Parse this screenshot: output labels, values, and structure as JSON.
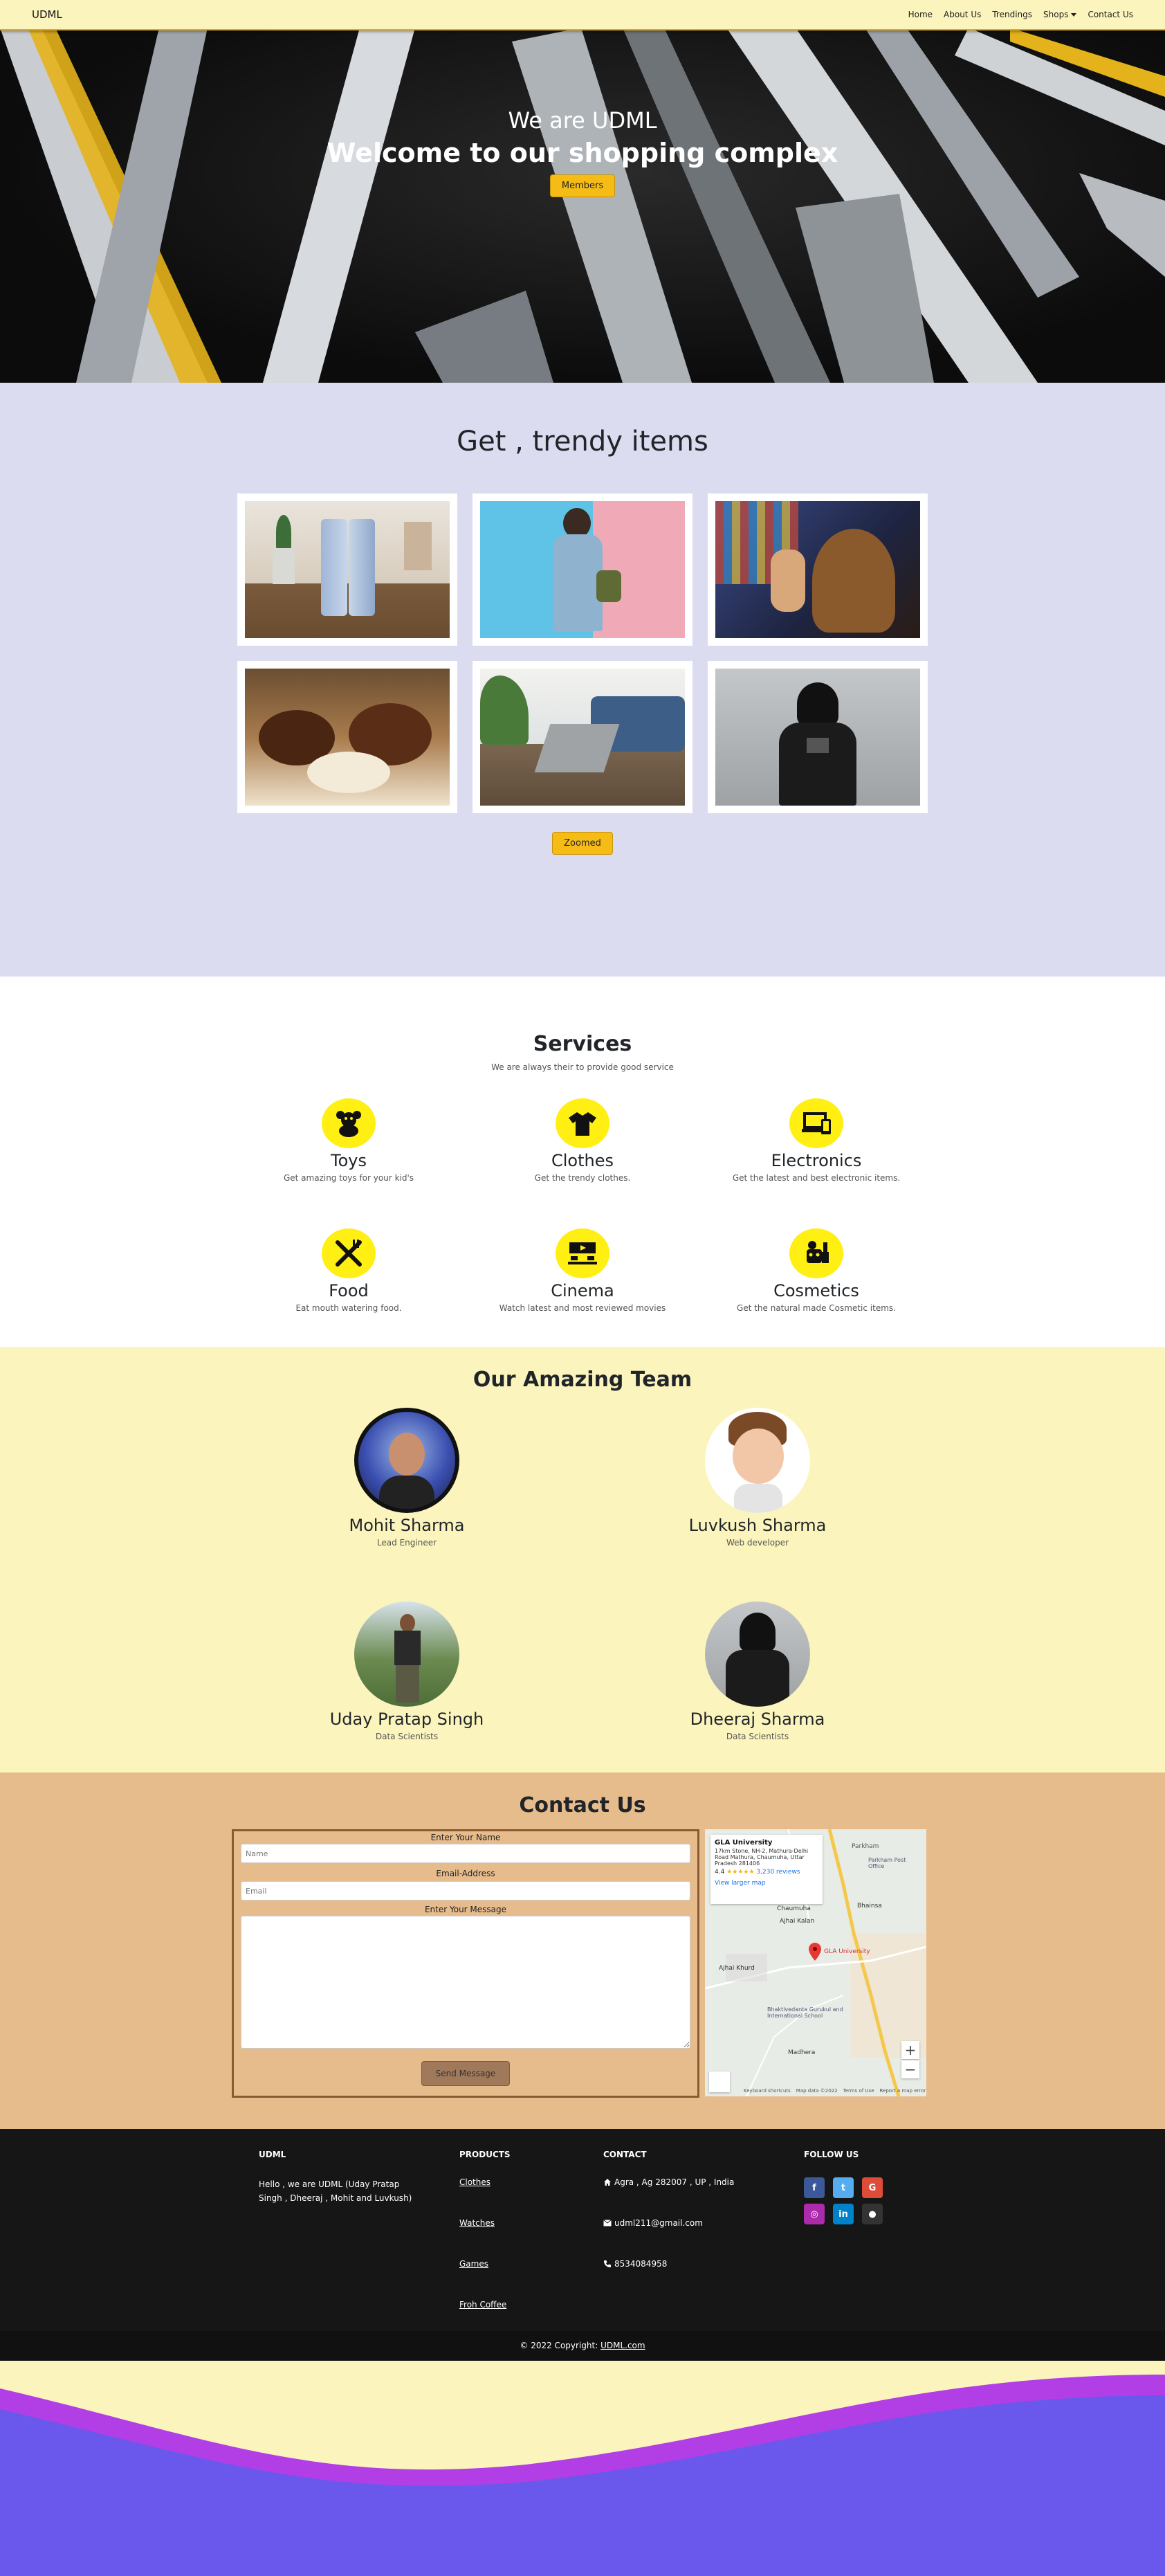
{
  "nav": {
    "brand": "UDML",
    "links": [
      "Home",
      "About Us",
      "Trendings",
      "Shops",
      "Contact Us"
    ]
  },
  "hero": {
    "subtitle": "We are UDML",
    "title": "Welcome to our shopping complex",
    "button": "Members"
  },
  "trendy": {
    "title": "Get , trendy items",
    "button": "Zoomed"
  },
  "services": {
    "title": "Services",
    "tagline": "We are always their to provide good service",
    "items": [
      {
        "name": "Toys",
        "desc": "Get amazing toys for your kid's",
        "icon": "teddy-bear-icon"
      },
      {
        "name": "Clothes",
        "desc": "Get the trendy clothes.",
        "icon": "shirt-icon"
      },
      {
        "name": "Electronics",
        "desc": "Get the latest and best electronic items.",
        "icon": "devices-icon"
      },
      {
        "name": "Food",
        "desc": "Eat mouth watering food.",
        "icon": "utensils-icon"
      },
      {
        "name": "Cinema",
        "desc": "Watch latest and most reviewed movies",
        "icon": "cinema-icon"
      },
      {
        "name": "Cosmetics",
        "desc": "Get the natural made Cosmetic items.",
        "icon": "cosmetics-icon"
      }
    ]
  },
  "team": {
    "title": "Our Amazing Team",
    "members": [
      {
        "name": "Mohit Sharma",
        "role": "Lead Engineer"
      },
      {
        "name": "Luvkush Sharma",
        "role": "Web developer"
      },
      {
        "name": "Uday Pratap Singh",
        "role": "Data Scientists"
      },
      {
        "name": "Dheeraj Sharma",
        "role": "Data Scientists"
      }
    ]
  },
  "contact": {
    "title": "Contact Us",
    "name_label": "Enter Your Name",
    "name_placeholder": "Name",
    "email_label": "Email-Address",
    "email_placeholder": "Email",
    "message_label": "Enter Your Message",
    "send": "Send Message",
    "map": {
      "place": "GLA University",
      "address": "17km Stone, NH-2, Mathura-Delhi Road Mathura, Chaumuha, Uttar Pradesh 281406",
      "rating": "4.4",
      "reviews": "3,230 reviews",
      "link": "View larger map",
      "pin_label": "GLA University",
      "places": [
        "Parkham",
        "Parkham Post Office",
        "Chaumuha",
        "Ajhai Kalan",
        "Bhainsa",
        "Ajhai Khurd",
        "Bhaktivedanta Gurukul and International School",
        "Madhera"
      ],
      "footer": [
        "Keyboard shortcuts",
        "Map data ©2022",
        "Terms of Use",
        "Report a map error"
      ]
    }
  },
  "footer": {
    "col1_head": "UDML",
    "about": "Hello , we are UDML (Uday Pratap Singh , Dheeraj , Mohit and Luvkush)",
    "col2_head": "PRODUCTS",
    "products": [
      "Clothes",
      "Watches",
      "Games",
      "Froh Coffee"
    ],
    "col3_head": "CONTACT",
    "address": "Agra , Ag 282007 , UP , India",
    "email": "udml211@gmail.com",
    "phone": "8534084958",
    "col4_head": "FOLLOW US",
    "copyright": "© 2022 Copyright:",
    "copyright_link": "UDML.com"
  },
  "colors": {
    "nav_bg": "#fcf4bd",
    "accent": "#f6bc16",
    "trendy_bg": "#dbdcef",
    "service_circle": "#ffef12",
    "contact_bg": "#e7bc8c",
    "footer_bg": "#161616",
    "wave_violet": "#6a58ec",
    "wave_purple": "#b23ee6"
  }
}
